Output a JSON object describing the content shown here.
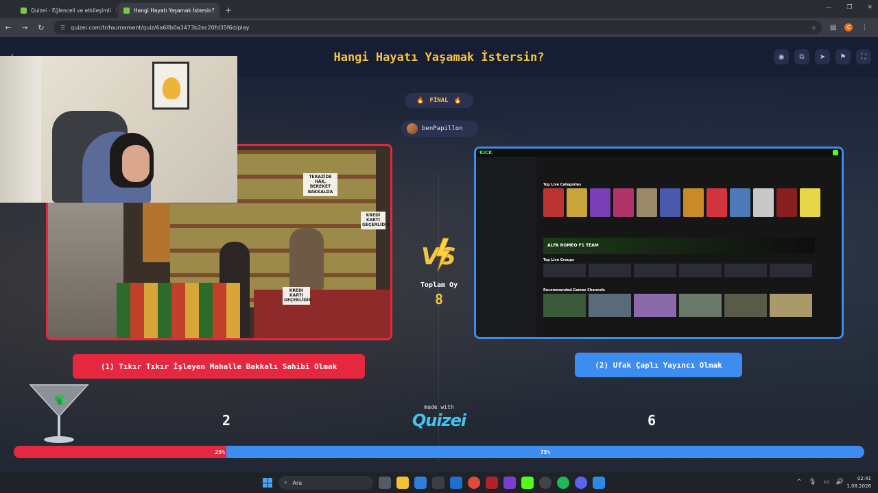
{
  "browser": {
    "tabs": [
      {
        "label": "Quizei - Eğlenceli ve etkileşimli",
        "active": false
      },
      {
        "label": "Hangi Hayatı Yaşamak İstersin?",
        "active": true
      }
    ],
    "url": "quizei.com/tr/tournament/quiz/6a68b0a3473b2ec20fd35f6d/play",
    "profile_initial": "C"
  },
  "page": {
    "title": "Hangi Hayatı Yaşamak İstersin?",
    "round_badge": "FİNAL",
    "user": "benPapillon"
  },
  "left_option": {
    "label": "(1) Tıkır Tıkır İşleyen Mahalle Bakkalı Sahibi Olmak",
    "votes": "2",
    "percent_label": "25%",
    "share": 0.25,
    "image_signs": [
      "TERAZİDE HAK, BEREKET BAKKALDA",
      "KREDİ KARTI GEÇERLİDİR",
      "KREDİ KARTI GEÇERLİDİR"
    ]
  },
  "right_option": {
    "label": "(2) Ufak Çaplı Yayıncı Olmak",
    "votes": "6",
    "percent_label": "75%",
    "share": 0.75,
    "screenshot": {
      "logo": "KICK",
      "sections": [
        "Top Live Categories",
        "Top Live Groups",
        "Recommended Games Channels"
      ],
      "banner_text": "ALFA ROMEO F1 TEAM"
    }
  },
  "center": {
    "total_label": "Toplam Oy",
    "total_value": "8"
  },
  "footer": {
    "made_with": "made with",
    "brand": "Quizei"
  },
  "taskbar": {
    "search_placeholder": "Ara",
    "time": "02:41",
    "date": "1.08.2026"
  },
  "colors": {
    "accent_red": "#e5283f",
    "accent_blue": "#3d8cf0",
    "title_yellow": "#f5c542"
  }
}
